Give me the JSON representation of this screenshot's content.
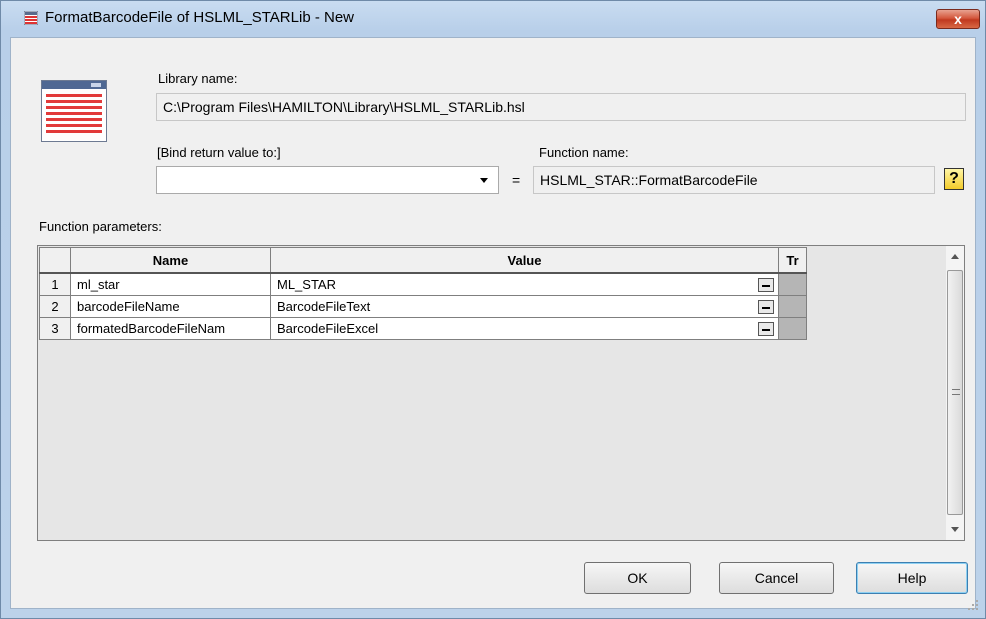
{
  "window": {
    "title": "FormatBarcodeFile of HSLML_STARLib - New",
    "close_glyph": "x",
    "icons": {
      "app": "table-icon",
      "library": "library-table-icon",
      "help": "question-mark-icon"
    }
  },
  "library": {
    "label": "Library name:",
    "value": "C:\\Program Files\\HAMILTON\\Library\\HSLML_STARLib.hsl"
  },
  "bind": {
    "label": "[Bind return value to:]",
    "value": "",
    "equals": "="
  },
  "function": {
    "label": "Function name:",
    "value": "HSLML_STAR::FormatBarcodeFile",
    "help_glyph": "?"
  },
  "params": {
    "label": "Function parameters:",
    "columns": {
      "name": "Name",
      "value": "Value",
      "tr": "Tr"
    },
    "rows": [
      {
        "num": "1",
        "name": "ml_star",
        "value": "ML_STAR"
      },
      {
        "num": "2",
        "name": "barcodeFileName",
        "value": "BarcodeFileText"
      },
      {
        "num": "3",
        "name": "formatedBarcodeFileNam",
        "value": "BarcodeFileExcel"
      }
    ]
  },
  "buttons": {
    "ok": "OK",
    "cancel": "Cancel",
    "help": "Help"
  },
  "colors": {
    "title_bg": "#c4d8ef",
    "client_bg": "#f0f0f0",
    "close_red": "#c9452a",
    "help_button_border": "#3c7fb1"
  }
}
